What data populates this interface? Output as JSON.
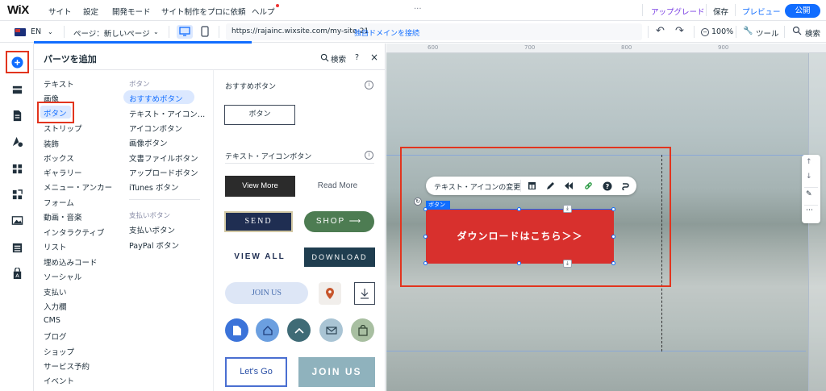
{
  "app": {
    "logo": "WiX"
  },
  "topmenu": {
    "items": [
      "サイト",
      "設定",
      "開発モード",
      "サイト制作をプロに依頼",
      "ヘルプ"
    ],
    "upgrade": "アップグレード",
    "save": "保存",
    "preview": "プレビュー",
    "publish": "公開",
    "more": "..."
  },
  "toolbar": {
    "language": "EN",
    "page_label": "ページ：新しいページ",
    "url": "https://rajainc.wixsite.com/my-site-21",
    "domain_link": "独自ドメインを接続",
    "zoom": "100%",
    "tools": "ツール",
    "search": "検索"
  },
  "panel": {
    "title": "パーツを追加",
    "search": "検索",
    "help": "?",
    "close": "×",
    "categories": [
      "テキスト",
      "画像",
      "ボタン",
      "ストリップ",
      "装飾",
      "ボックス",
      "ギャラリー",
      "メニュー・アンカー",
      "フォーム",
      "動画・音楽",
      "インタラクティブ",
      "リスト",
      "埋め込みコード",
      "ソーシャル",
      "支払い",
      "入力欄",
      "CMS",
      "ブログ",
      "ショップ",
      "サービス予約",
      "イベント"
    ],
    "sub_head_1": "ボタン",
    "sub_items_1": [
      "おすすめボタン",
      "テキスト・アイコン…",
      "アイコンボタン",
      "画像ボタン",
      "文書ファイルボタン",
      "アップロードボタン",
      "iTunes ボタン"
    ],
    "sub_head_2": "支払いボタン",
    "sub_items_2": [
      "支払いボタン",
      "PayPal ボタン"
    ],
    "section_1": "おすすめボタン",
    "section_2": "テキスト・アイコンボタン",
    "samples": {
      "button": "ボタン",
      "view_more_dark": "View More",
      "read_more": "Read More",
      "send": "SEND",
      "shop": "SHOP ⟶",
      "view_all": "VIEW ALL",
      "download": "DOWNLOAD",
      "join_us": "JOIN US",
      "lets_go": "Let's Go",
      "join_us_2": "JOIN US"
    }
  },
  "canvas": {
    "ruler": [
      "600",
      "700",
      "800",
      "900"
    ],
    "context_label": "テキスト・アイコンの変更",
    "element_tag": "ボタン",
    "button_text": "ダウンロードはこちら＞＞",
    "colors": {
      "button": "#d8302d",
      "accent": "#116dff",
      "highlight": "#e2341e"
    }
  }
}
